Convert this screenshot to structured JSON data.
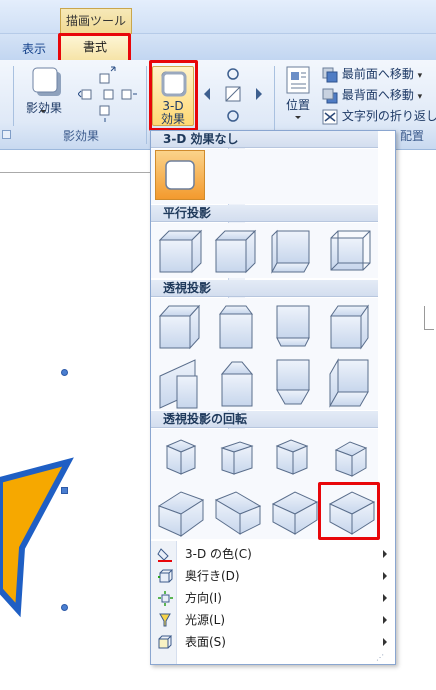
{
  "ribbon": {
    "context_tab": "描画ツール",
    "tabs": [
      {
        "label": "表示"
      },
      {
        "label": "書式"
      }
    ],
    "shadow_effects": {
      "button": "影効果",
      "group": "影効果"
    },
    "effects_3d": {
      "button_line1": "3-D",
      "button_line2": "効果"
    },
    "position": {
      "button": "位置"
    },
    "arrange": {
      "bring_front": "最前面へ移動",
      "send_back": "最背面へ移動",
      "text_wrap": "文字列の折り返し",
      "group_label": "配置"
    }
  },
  "dropdown": {
    "sections": [
      {
        "title": "3-D 効果なし"
      },
      {
        "title": "平行投影"
      },
      {
        "title": "透視投影"
      },
      {
        "title": "透視投影の回転"
      }
    ],
    "menu": [
      {
        "label": "3-D の色(C)",
        "icon": "paint-bucket-icon"
      },
      {
        "label": "奥行き(D)",
        "icon": "depth-icon"
      },
      {
        "label": "方向(I)",
        "icon": "direction-icon"
      },
      {
        "label": "光源(L)",
        "icon": "lighting-icon"
      },
      {
        "label": "表面(S)",
        "icon": "surface-icon"
      }
    ]
  },
  "colors": {
    "highlight_red": "#e8060a",
    "star_fill": "#f6a800",
    "star_outline": "#1f5fc4",
    "selected_cell": "#f7b04b"
  }
}
